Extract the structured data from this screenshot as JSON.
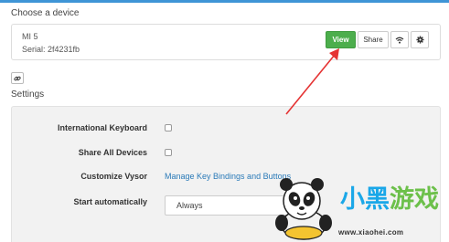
{
  "header": {
    "title": "Choose a device"
  },
  "device": {
    "name": "MI 5",
    "serial": "Serial: 2f4231fb",
    "buttons": {
      "view": "View",
      "share": "Share"
    },
    "icons": {
      "wifi": "wifi-icon",
      "settings": "gear-icon"
    }
  },
  "link_button": {
    "icon": "link-icon"
  },
  "settings": {
    "title": "Settings",
    "rows": [
      {
        "label": "International Keyboard",
        "checked": false
      },
      {
        "label": "Share All Devices",
        "checked": false
      },
      {
        "label": "Customize Vysor",
        "link": "Manage Key Bindings and Buttons"
      },
      {
        "label": "Start automatically",
        "select_value": "Always"
      }
    ]
  },
  "watermark": {
    "brand": "小黑游戏",
    "url": "www.xiaohei.com"
  },
  "colors": {
    "accent_top": "#3f95d6",
    "view_button": "#4cae4c",
    "link": "#2a7ab8",
    "arrow": "#e53333"
  }
}
